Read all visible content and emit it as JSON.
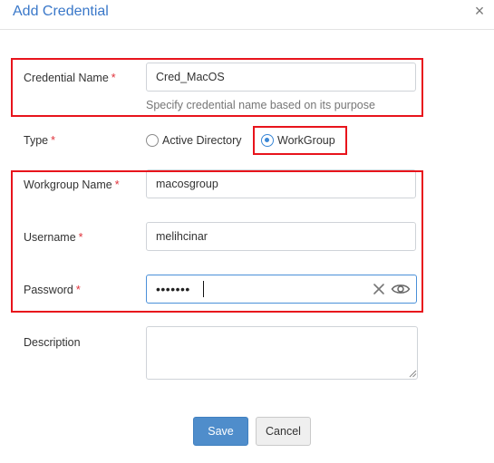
{
  "dialog": {
    "title": "Add Credential",
    "close_symbol": "×"
  },
  "fields": {
    "credential_name": {
      "label": "Credential Name",
      "required_mark": "*",
      "value": "Cred_MacOS",
      "hint": "Specify credential name based on its purpose"
    },
    "type": {
      "label": "Type",
      "required_mark": "*",
      "options": [
        "Active Directory",
        "WorkGroup"
      ],
      "selected": "WorkGroup"
    },
    "workgroup_name": {
      "label": "Workgroup Name",
      "required_mark": "*",
      "value": "macosgroup"
    },
    "username": {
      "label": "Username",
      "required_mark": "*",
      "value": "melihcinar"
    },
    "password": {
      "label": "Password",
      "required_mark": "*",
      "masked_value": "•••••••"
    },
    "description": {
      "label": "Description",
      "value": ""
    }
  },
  "buttons": {
    "save": "Save",
    "cancel": "Cancel"
  },
  "colors": {
    "accent": "#3a78c9",
    "required": "#e0313a",
    "highlight": "#e8141c",
    "save_button": "#4f8dcb"
  }
}
